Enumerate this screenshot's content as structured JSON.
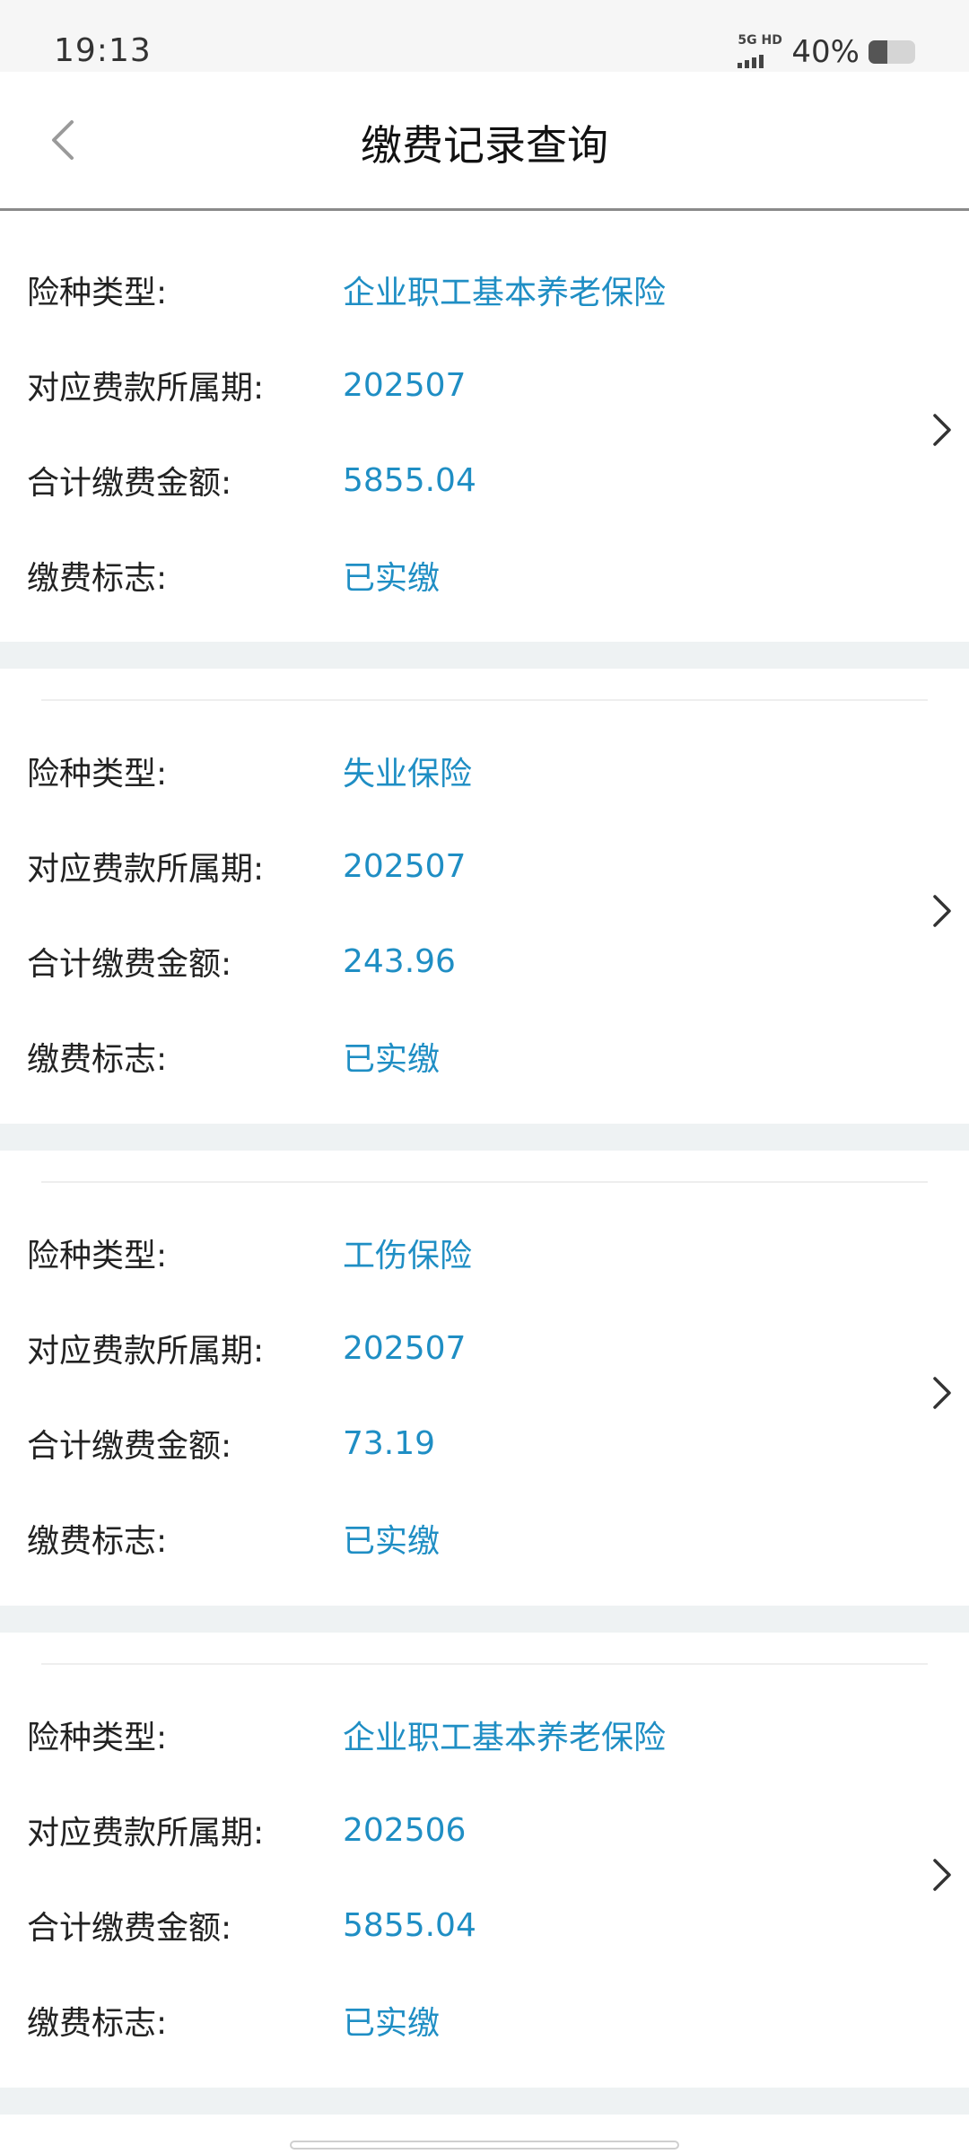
{
  "status_bar": {
    "time": "19:13",
    "network_label": "5G HD",
    "battery_percent": "40%"
  },
  "nav": {
    "title": "缴费记录查询"
  },
  "labels": {
    "type": "险种类型:",
    "period": "对应费款所属期:",
    "amount": "合计缴费金额:",
    "status": "缴费标志:"
  },
  "records": [
    {
      "type": "企业职工基本养老保险",
      "period": "202507",
      "amount": "5855.04",
      "status": "已实缴"
    },
    {
      "type": "失业保险",
      "period": "202507",
      "amount": "243.96",
      "status": "已实缴"
    },
    {
      "type": "工伤保险",
      "period": "202507",
      "amount": "73.19",
      "status": "已实缴"
    },
    {
      "type": "企业职工基本养老保险",
      "period": "202506",
      "amount": "5855.04",
      "status": "已实缴"
    }
  ],
  "colors": {
    "accent": "#1f8ec4",
    "separator": "#eef2f3"
  }
}
